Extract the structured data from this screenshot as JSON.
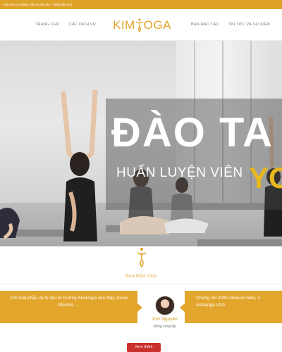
{
  "topbar": {
    "contact": "mail.com | Hotline: 093 54 58 224 - 0988 888 841"
  },
  "nav": {
    "items_left": [
      "Trang chủ",
      "Các dịch vụ"
    ],
    "items_right": [
      "Ban đào tạo",
      "Tin tức và sự kiện"
    ],
    "logo": {
      "prefix": "KIM",
      "suffix": "OGA"
    }
  },
  "hero": {
    "title_line1": "ĐÀO TA",
    "title_line2": "HUẤN LUYỆN VIÊN",
    "title_line3": "YO"
  },
  "section": {
    "title": "BAN ĐÀO TẠO",
    "card_left": "100 Giải phẫu và trị liệu từ trường Shantaya của thầy Jonas Westrin, ...",
    "card_right": "Chứng chỉ 200h Alliance India, 4 Ashtanga USA",
    "trainer_name": "Kim Nguyên",
    "trainer_role": "Đồng sáng lập",
    "more_label": "Xem thêm"
  },
  "colors": {
    "accent": "#e0a32a",
    "button": "#c9302c",
    "title_yellow": "#e8b71e"
  }
}
